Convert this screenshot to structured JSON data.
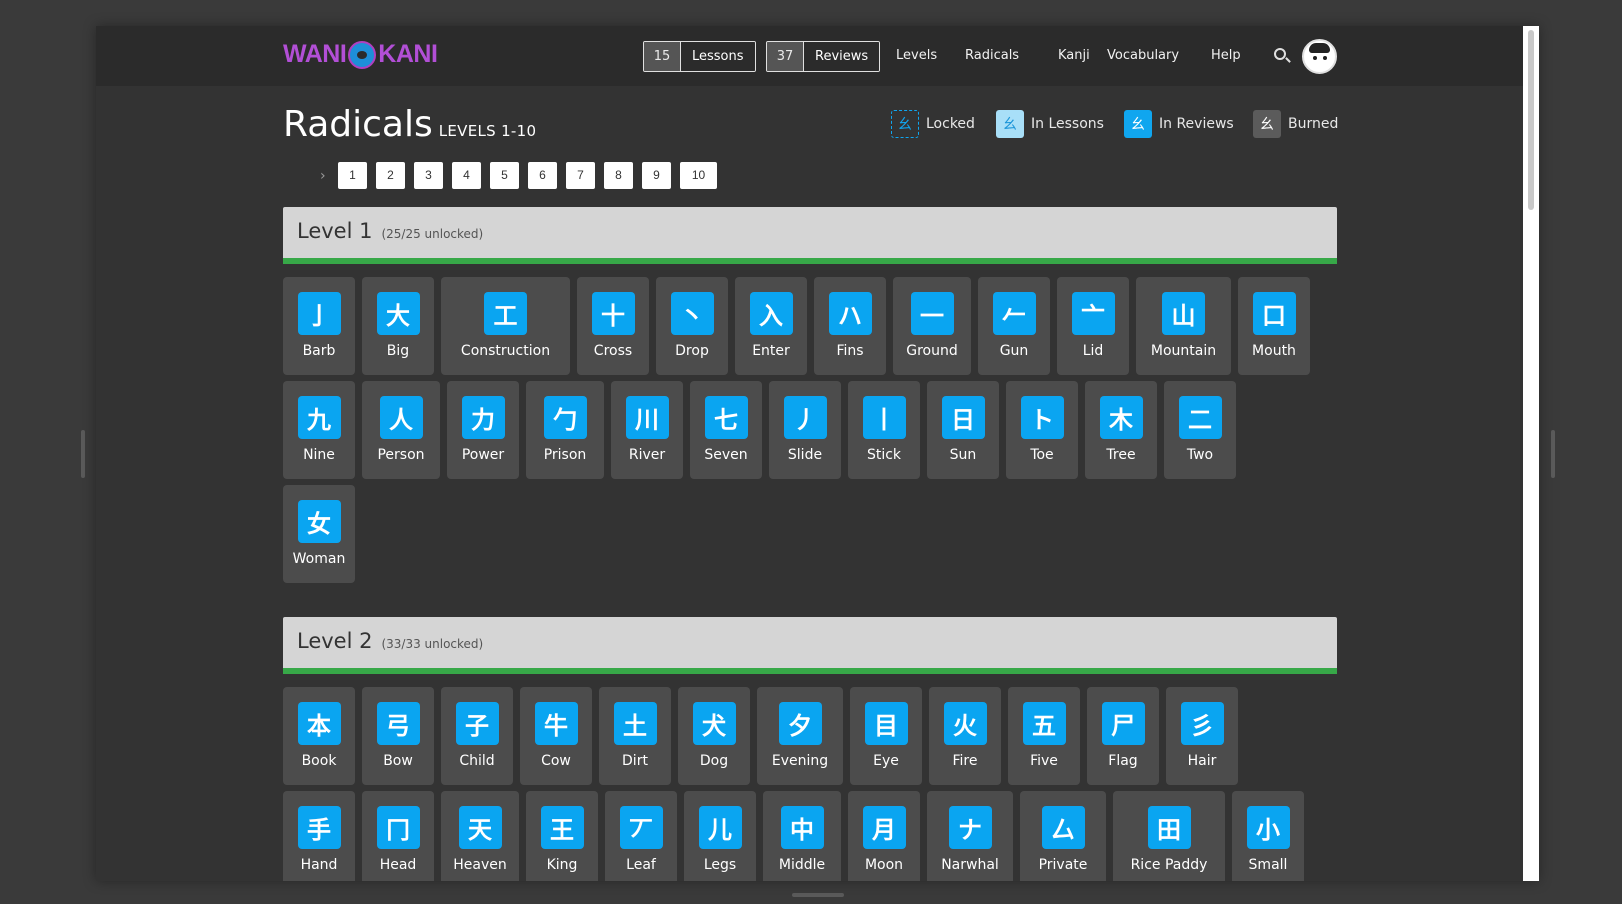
{
  "app": {
    "logo_left": "WANI",
    "logo_right": "KANI"
  },
  "nav": {
    "lessons": {
      "count": "15",
      "label": "Lessons"
    },
    "reviews": {
      "count": "37",
      "label": "Reviews"
    },
    "links": [
      "Levels",
      "Radicals",
      "Kanji",
      "Vocabulary",
      "Help"
    ],
    "search_icon": "search-icon",
    "avatar_icon": "avatar"
  },
  "page": {
    "title": "Radicals",
    "subtitle": "LEVELS 1-10"
  },
  "legend": [
    {
      "label": "Locked",
      "glyph": "幺",
      "state": "locked"
    },
    {
      "label": "In Lessons",
      "glyph": "幺",
      "state": "lessons"
    },
    {
      "label": "In Reviews",
      "glyph": "幺",
      "state": "reviews"
    },
    {
      "label": "Burned",
      "glyph": "幺",
      "state": "burned"
    }
  ],
  "pager": {
    "chevron": "›",
    "pages": [
      "1",
      "2",
      "3",
      "4",
      "5",
      "6",
      "7",
      "8",
      "9",
      "10"
    ]
  },
  "colors": {
    "accent_blue": "#0aa5f1",
    "progress_green": "#37a848",
    "logo_purple": "#b24fd6"
  },
  "levels": [
    {
      "title": "Level 1",
      "unlocked": "(25/25 unlocked)",
      "progress": 1.0,
      "rows": [
        [
          {
            "g": "亅",
            "n": "Barb"
          },
          {
            "g": "大",
            "n": "Big"
          },
          {
            "g": "工",
            "n": "Construction"
          },
          {
            "g": "十",
            "n": "Cross"
          },
          {
            "g": "丶",
            "n": "Drop"
          },
          {
            "g": "入",
            "n": "Enter"
          },
          {
            "g": "ハ",
            "n": "Fins"
          },
          {
            "g": "一",
            "n": "Ground"
          },
          {
            "g": "𠂉",
            "n": "Gun"
          },
          {
            "g": "亠",
            "n": "Lid"
          },
          {
            "g": "山",
            "n": "Mountain"
          },
          {
            "g": "口",
            "n": "Mouth"
          }
        ],
        [
          {
            "g": "九",
            "n": "Nine"
          },
          {
            "g": "人",
            "n": "Person"
          },
          {
            "g": "力",
            "n": "Power"
          },
          {
            "g": "勹",
            "n": "Prison"
          },
          {
            "g": "川",
            "n": "River"
          },
          {
            "g": "七",
            "n": "Seven"
          },
          {
            "g": "丿",
            "n": "Slide"
          },
          {
            "g": "丨",
            "n": "Stick"
          },
          {
            "g": "日",
            "n": "Sun"
          },
          {
            "g": "ト",
            "n": "Toe"
          },
          {
            "g": "木",
            "n": "Tree"
          },
          {
            "g": "二",
            "n": "Two"
          }
        ],
        [
          {
            "g": "女",
            "n": "Woman"
          }
        ]
      ]
    },
    {
      "title": "Level 2",
      "unlocked": "(33/33 unlocked)",
      "progress": 1.0,
      "rows": [
        [
          {
            "g": "本",
            "n": "Book"
          },
          {
            "g": "弓",
            "n": "Bow"
          },
          {
            "g": "子",
            "n": "Child"
          },
          {
            "g": "牛",
            "n": "Cow"
          },
          {
            "g": "土",
            "n": "Dirt"
          },
          {
            "g": "犬",
            "n": "Dog"
          },
          {
            "g": "夕",
            "n": "Evening"
          },
          {
            "g": "目",
            "n": "Eye"
          },
          {
            "g": "火",
            "n": "Fire"
          },
          {
            "g": "五",
            "n": "Five"
          },
          {
            "g": "尸",
            "n": "Flag"
          },
          {
            "g": "彡",
            "n": "Hair"
          }
        ],
        [
          {
            "g": "手",
            "n": "Hand"
          },
          {
            "g": "冂",
            "n": "Head"
          },
          {
            "g": "天",
            "n": "Heaven"
          },
          {
            "g": "王",
            "n": "King"
          },
          {
            "g": "丆",
            "n": "Leaf"
          },
          {
            "g": "儿",
            "n": "Legs"
          },
          {
            "g": "中",
            "n": "Middle"
          },
          {
            "g": "月",
            "n": "Moon"
          },
          {
            "g": "ナ",
            "n": "Narwhal"
          },
          {
            "g": "厶",
            "n": "Private"
          },
          {
            "g": "田",
            "n": "Rice Paddy"
          },
          {
            "g": "小",
            "n": "Small"
          }
        ]
      ]
    }
  ]
}
